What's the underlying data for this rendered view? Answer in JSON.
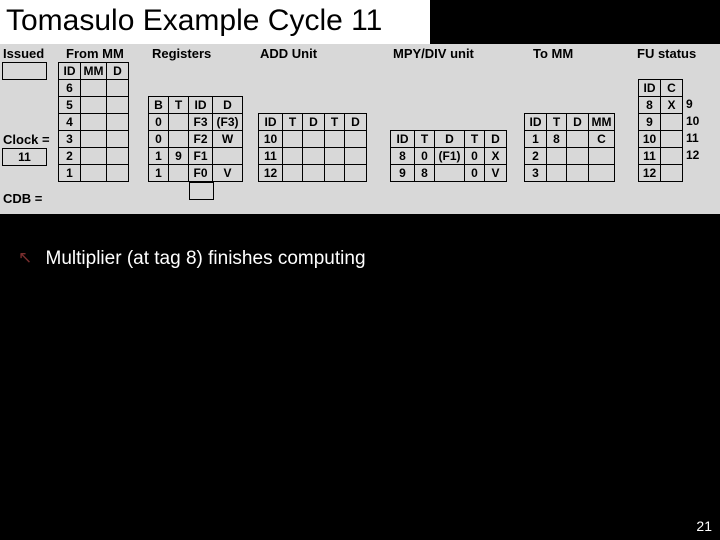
{
  "title": "Tomasulo Example Cycle 11",
  "headers": {
    "issued": "Issued",
    "frommm": "From MM",
    "registers": "Registers",
    "addunit": "ADD Unit",
    "mpydiv": "MPY/DIV unit",
    "tomm": "To MM",
    "fustatus": "FU status",
    "clock": "Clock =",
    "cdb": "CDB ="
  },
  "frommm": {
    "h1": "ID",
    "h2": "MM",
    "h3": "D",
    "r": [
      "6",
      "5",
      "4",
      "3",
      "2",
      "1"
    ]
  },
  "clock_val": "11",
  "registers": {
    "h": [
      "B",
      "T",
      "ID",
      "D"
    ],
    "rows": [
      [
        "0",
        "",
        "F3",
        "(F3)"
      ],
      [
        "0",
        "",
        "F2",
        "W"
      ],
      [
        "1",
        "9",
        "F1",
        ""
      ],
      [
        "1",
        "",
        "F0",
        "V"
      ]
    ]
  },
  "addunit": {
    "h": [
      "ID",
      "T",
      "D",
      "T",
      "D"
    ],
    "rows": [
      [
        "10",
        "",
        "",
        "",
        ""
      ],
      [
        "11",
        "",
        "",
        "",
        ""
      ],
      [
        "12",
        "",
        "",
        "",
        ""
      ]
    ]
  },
  "mpydiv": {
    "h": [
      "ID",
      "T",
      "D",
      "T",
      "D"
    ],
    "rows": [
      [
        "8",
        "0",
        "(F1)",
        "0",
        "X"
      ],
      [
        "9",
        "8",
        "",
        "0",
        "V"
      ]
    ]
  },
  "tomm": {
    "h": [
      "ID",
      "T",
      "D",
      "MM"
    ],
    "rows": [
      [
        "1",
        "8",
        "",
        "C"
      ],
      [
        "2",
        "",
        "",
        ""
      ],
      [
        "3",
        "",
        "",
        ""
      ]
    ]
  },
  "fustatus": {
    "h": [
      "ID",
      "C"
    ],
    "rows": [
      [
        "8",
        "X"
      ],
      [
        "9",
        ""
      ],
      [
        "10",
        ""
      ],
      [
        "11",
        ""
      ],
      [
        "12",
        ""
      ]
    ]
  },
  "bullet": "Multiplier (at tag 8) finishes computing",
  "pagenum": "21"
}
